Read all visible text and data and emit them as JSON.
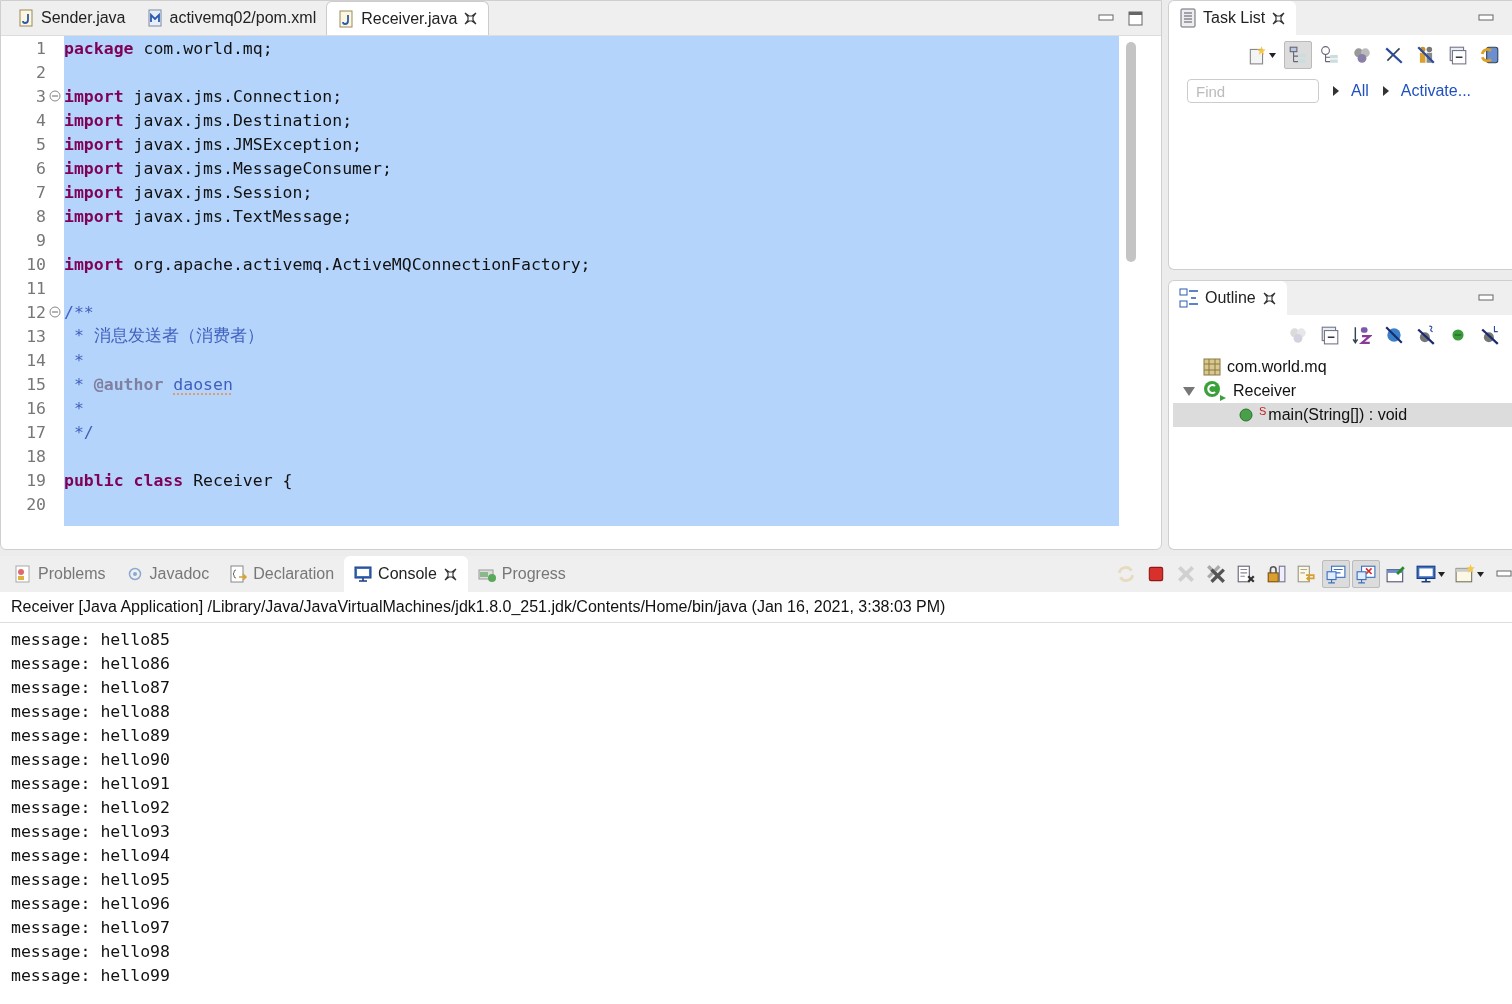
{
  "editor": {
    "tabs": [
      {
        "label": "Sender.java",
        "kind": "java",
        "selected": false
      },
      {
        "label": "activemq02/pom.xml",
        "kind": "maven",
        "selected": false
      },
      {
        "label": "Receiver.java",
        "kind": "java",
        "selected": true
      }
    ],
    "lines": [
      {
        "number": "1",
        "fold_marker": false,
        "tokens": [
          {
            "kind": "keyword",
            "text": "package"
          },
          {
            "kind": "plain",
            "text": " com.world.mq;"
          }
        ]
      },
      {
        "number": "2",
        "fold_marker": false
      },
      {
        "number": "3",
        "fold_marker": true,
        "tokens": [
          {
            "kind": "keyword",
            "text": "import"
          },
          {
            "kind": "plain",
            "text": " javax.jms.Connection;"
          }
        ]
      },
      {
        "number": "4",
        "fold_marker": false,
        "tokens": [
          {
            "kind": "keyword",
            "text": "import"
          },
          {
            "kind": "plain",
            "text": " javax.jms.Destination;"
          }
        ]
      },
      {
        "number": "5",
        "fold_marker": false,
        "tokens": [
          {
            "kind": "keyword",
            "text": "import"
          },
          {
            "kind": "plain",
            "text": " javax.jms.JMSException;"
          }
        ]
      },
      {
        "number": "6",
        "fold_marker": false,
        "tokens": [
          {
            "kind": "keyword",
            "text": "import"
          },
          {
            "kind": "plain",
            "text": " javax.jms.MessageConsumer;"
          }
        ]
      },
      {
        "number": "7",
        "fold_marker": false,
        "tokens": [
          {
            "kind": "keyword",
            "text": "import"
          },
          {
            "kind": "plain",
            "text": " javax.jms.Session;"
          }
        ]
      },
      {
        "number": "8",
        "fold_marker": false,
        "tokens": [
          {
            "kind": "keyword",
            "text": "import"
          },
          {
            "kind": "plain",
            "text": " javax.jms.TextMessage;"
          }
        ]
      },
      {
        "number": "9",
        "fold_marker": false
      },
      {
        "number": "10",
        "fold_marker": false,
        "tokens": [
          {
            "kind": "keyword",
            "text": "import"
          },
          {
            "kind": "plain",
            "text": " org.apache.activemq.ActiveMQConnectionFactory;"
          }
        ]
      },
      {
        "number": "11",
        "fold_marker": false
      },
      {
        "number": "12",
        "fold_marker": true,
        "tokens": [
          {
            "kind": "comment",
            "text": "/**"
          }
        ]
      },
      {
        "number": "13",
        "fold_marker": false,
        "tokens": [
          {
            "kind": "comment",
            "text": " * 消息发送者（消费者）"
          }
        ]
      },
      {
        "number": "14",
        "fold_marker": false,
        "tokens": [
          {
            "kind": "comment",
            "text": " *"
          }
        ]
      },
      {
        "number": "15",
        "fold_marker": false,
        "tokens": [
          {
            "kind": "comment",
            "text": " * "
          },
          {
            "kind": "tag",
            "text": "@author "
          },
          {
            "kind": "flagged",
            "text": "daosen"
          }
        ]
      },
      {
        "number": "16",
        "fold_marker": false,
        "tokens": [
          {
            "kind": "comment",
            "text": " *"
          }
        ]
      },
      {
        "number": "17",
        "fold_marker": false,
        "tokens": [
          {
            "kind": "comment",
            "text": " */"
          }
        ]
      },
      {
        "number": "18",
        "fold_marker": false
      },
      {
        "number": "19",
        "fold_marker": false,
        "tokens": [
          {
            "kind": "keyword",
            "text": "public"
          },
          {
            "kind": "keyword",
            "text": " class"
          },
          {
            "kind": "plain",
            "text": " Receiver {"
          }
        ]
      },
      {
        "number": "20",
        "fold_marker": false
      }
    ]
  },
  "task_list": {
    "title": "Task List",
    "toolbar": [
      {
        "kind": "new-task",
        "pressed": false,
        "disabled": false
      },
      {
        "kind": "categorized",
        "pressed": true,
        "disabled": false
      },
      {
        "kind": "scheduled",
        "pressed": false,
        "disabled": false
      },
      {
        "kind": "focus",
        "pressed": false,
        "disabled": false
      },
      {
        "kind": "hide-completed",
        "pressed": false,
        "disabled": false
      },
      {
        "kind": "people",
        "pressed": false,
        "disabled": false
      },
      {
        "kind": "collapse",
        "pressed": false,
        "disabled": false
      },
      {
        "kind": "sync",
        "pressed": false,
        "disabled": false
      }
    ],
    "find": {
      "placeholder": "Find"
    },
    "links": [
      "All",
      "Activate..."
    ]
  },
  "outline": {
    "title": "Outline",
    "toolbar": [
      {
        "kind": "focus",
        "pressed": false,
        "disabled": true
      },
      {
        "kind": "collapse",
        "pressed": false,
        "disabled": false
      },
      {
        "kind": "sort",
        "pressed": false,
        "disabled": false
      },
      {
        "kind": "hide-fields",
        "pressed": false,
        "disabled": false
      },
      {
        "kind": "hide-static",
        "pressed": false,
        "disabled": false
      },
      {
        "kind": "hide-nonpublic",
        "pressed": false,
        "disabled": false
      },
      {
        "kind": "hide-local",
        "pressed": false,
        "disabled": false
      }
    ],
    "tree": [
      {
        "label": "com.world.mq",
        "kind": "package",
        "selected": false
      },
      {
        "label": "Receiver",
        "kind": "class",
        "expanded": true,
        "selected": false,
        "children": [
          {
            "label": "main(String[]) : void",
            "kind": "method",
            "badge": "S",
            "selected": true
          }
        ]
      }
    ]
  },
  "console": {
    "tabs": [
      {
        "label": "Problems",
        "kind": "problems",
        "selected": false
      },
      {
        "label": "Javadoc",
        "kind": "javadoc",
        "selected": false
      },
      {
        "label": "Declaration",
        "kind": "declaration",
        "selected": false
      },
      {
        "label": "Console",
        "kind": "console",
        "selected": true
      },
      {
        "label": "Progress",
        "kind": "progress",
        "selected": false
      }
    ],
    "toolbar": [
      {
        "kind": "relaunch",
        "pressed": false,
        "disabled": true
      },
      {
        "kind": "stop",
        "pressed": false,
        "disabled": false
      },
      {
        "kind": "remove",
        "pressed": false,
        "disabled": true
      },
      {
        "kind": "remove-all",
        "pressed": false,
        "disabled": false
      },
      {
        "kind": "clear",
        "pressed": false,
        "disabled": false
      },
      {
        "kind": "scroll-lock",
        "pressed": false,
        "disabled": false
      },
      {
        "kind": "word-wrap",
        "pressed": false,
        "disabled": false
      },
      {
        "kind": "show-stdout",
        "pressed": true,
        "disabled": false
      },
      {
        "kind": "show-stderr",
        "pressed": true,
        "disabled": false
      },
      {
        "kind": "pin",
        "pressed": false,
        "disabled": false
      },
      {
        "kind": "display-console",
        "pressed": false,
        "disabled": false
      },
      {
        "kind": "open-console",
        "pressed": false,
        "disabled": false
      }
    ],
    "process": "Receiver [Java Application] /Library/Java/JavaVirtualMachines/jdk1.8.0_251.jdk/Contents/Home/bin/java  (Jan 16, 2021, 3:38:03 PM)",
    "output": [
      "message: hello85",
      "message: hello86",
      "message: hello87",
      "message: hello88",
      "message: hello89",
      "message: hello90",
      "message: hello91",
      "message: hello92",
      "message: hello93",
      "message: hello94",
      "message: hello95",
      "message: hello96",
      "message: hello97",
      "message: hello98",
      "message: hello99"
    ]
  }
}
